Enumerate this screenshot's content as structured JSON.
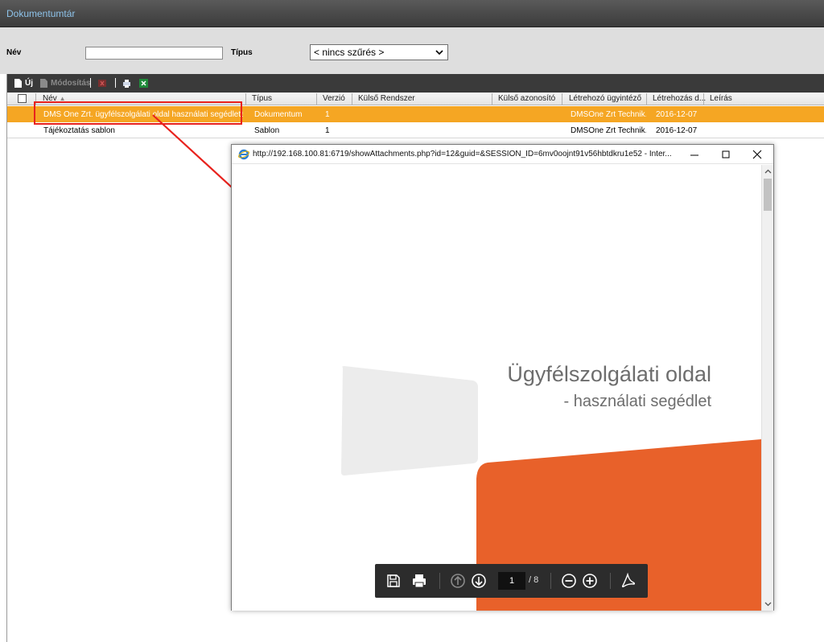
{
  "app": {
    "title": "Dokumentumtár"
  },
  "filters": {
    "name_label": "Név",
    "name_value": "",
    "type_label": "Típus",
    "type_selected": "< nincs szűrés >"
  },
  "toolbar": {
    "new_label": "Új",
    "edit_label": "Módosítás"
  },
  "columns": [
    "Név",
    "Típus",
    "Verzió",
    "Külső Rendszer",
    "Külső azonosító",
    "Létrehozó ügyintéző",
    "Létrehozás d...",
    "Leírás"
  ],
  "rows": [
    {
      "name": "DMS One Zrt. ügyfélszolgálati oldal használati segédlete",
      "type": "Dokumentum",
      "version": "1",
      "creator": "DMSOne Zrt Technik...",
      "date": "2016-12-07"
    },
    {
      "name": "Tájékoztatás sablon",
      "type": "Sablon",
      "version": "1",
      "creator": "DMSOne Zrt Technik...",
      "date": "2016-12-07"
    }
  ],
  "popup": {
    "url": "http://192.168.100.81:6719/showAttachments.php?id=12&guid=&SESSION_ID=6mv0oojnt91v56hbtdkru1e52 - Inter...",
    "slide_title": "Ügyfélszolgálati oldal",
    "slide_subtitle": "- használati segédlet",
    "page_current": "1",
    "page_total": "/ 8"
  },
  "colors": {
    "selected_row": "#f5a623",
    "highlight": "#e8221d",
    "slide_orange": "#e8612a"
  },
  "icons": [
    "save-icon",
    "print-icon",
    "page-up-icon",
    "page-down-icon",
    "zoom-out-icon",
    "zoom-in-icon",
    "acrobat-icon",
    "ie-icon"
  ]
}
